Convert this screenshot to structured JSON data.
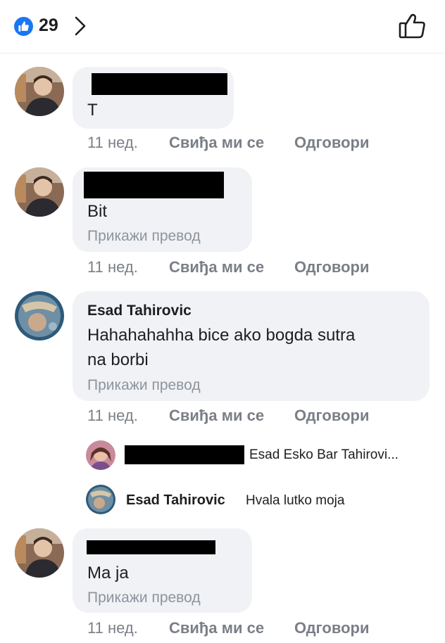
{
  "header": {
    "like_count": "29",
    "like_icon": "like-badge-icon",
    "chevron_icon": "chevron-right-icon",
    "like_button_icon": "thumbs-up-outline-icon",
    "accent": "#1877f2"
  },
  "actions": {
    "time": "11 нед.",
    "like": "Свиђа ми се",
    "reply": "Одговори"
  },
  "comments": [
    {
      "author": "",
      "text": "T",
      "translate": ""
    },
    {
      "author": "",
      "text": "Bit",
      "translate": "Прикажи превод"
    },
    {
      "author": "Esad Tahirovic",
      "text_line1": "Hahahahahha bice ako bogda sutra",
      "text_line2": "na borbi",
      "translate": "Прикажи превод"
    },
    {
      "author": "",
      "text": "Ma ja",
      "translate": "Прикажи превод"
    }
  ],
  "replies": [
    {
      "author": "",
      "text": "Esad Esko Bar Tahirovi..."
    },
    {
      "author": "Esad Tahirovic",
      "text": "Hvala lutko moja"
    }
  ]
}
